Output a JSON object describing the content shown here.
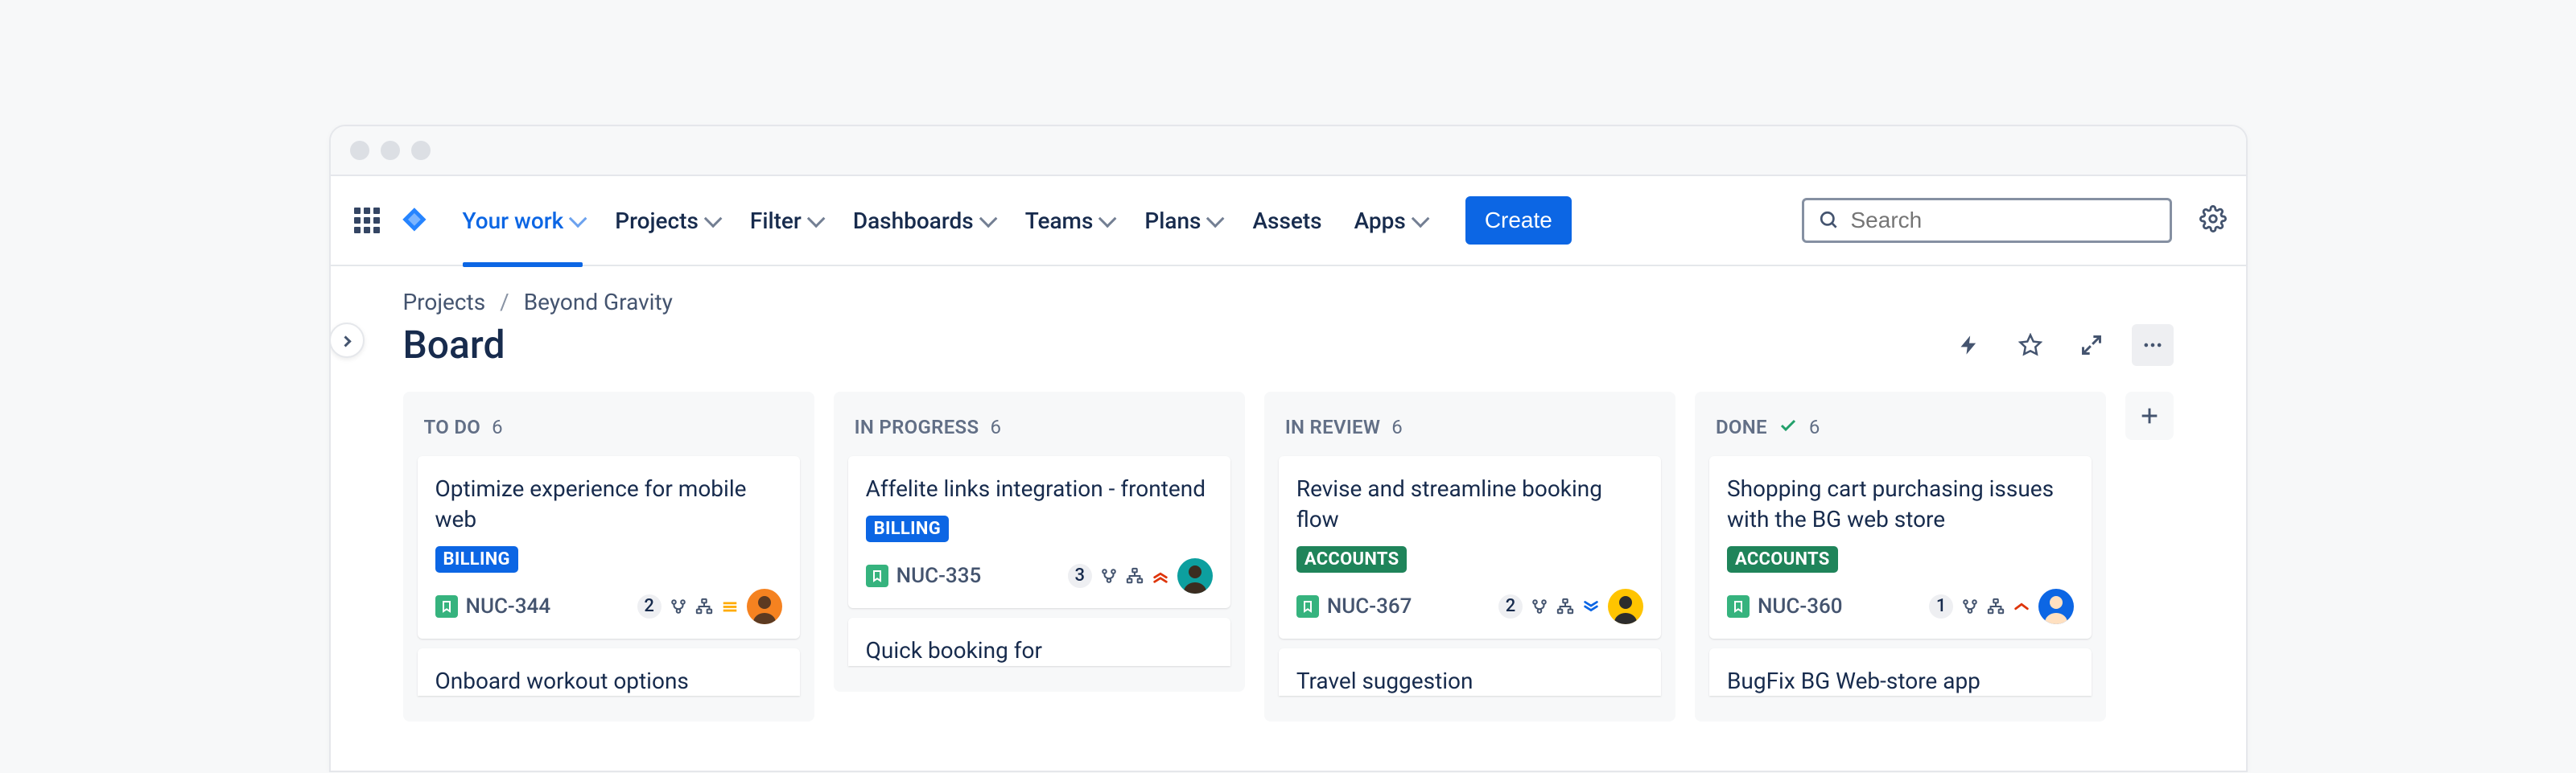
{
  "nav": {
    "your_work": "Your work",
    "projects": "Projects",
    "filter": "Filter",
    "dashboards": "Dashboards",
    "teams": "Teams",
    "plans": "Plans",
    "assets": "Assets",
    "apps": "Apps",
    "create": "Create"
  },
  "search": {
    "placeholder": "Search"
  },
  "breadcrumbs": {
    "root": "Projects",
    "project": "Beyond Gravity"
  },
  "page": {
    "title": "Board"
  },
  "columns": [
    {
      "title": "TO DO",
      "count": "6",
      "done": false
    },
    {
      "title": "IN PROGRESS",
      "count": "6",
      "done": false
    },
    {
      "title": "IN REVIEW",
      "count": "6",
      "done": false
    },
    {
      "title": "DONE",
      "count": "6",
      "done": true
    }
  ],
  "cards": [
    {
      "col": 0,
      "title": "Optimize experience for mobile web",
      "tag": "BILLING",
      "tag_color": "blue",
      "key": "NUC-344",
      "count": "2",
      "priority": "medium-yellow",
      "avatar": "#F58220|#5C3A21"
    },
    {
      "col": 1,
      "title": "Affelite links integration - frontend",
      "tag": "BILLING",
      "tag_color": "blue",
      "key": "NUC-335",
      "count": "3",
      "priority": "high-red",
      "avatar": "#0D9F9F|#3B2C20"
    },
    {
      "col": 2,
      "title": "Revise and streamline booking flow",
      "tag": "ACCOUNTS",
      "tag_color": "green",
      "key": "NUC-367",
      "count": "2",
      "priority": "low-blue",
      "avatar": "#FFC400|#2C2C2C"
    },
    {
      "col": 3,
      "title": "Shopping cart purchasing issues with the BG web store",
      "tag": "ACCOUNTS",
      "tag_color": "green",
      "key": "NUC-360",
      "count": "1",
      "priority": "single-red",
      "avatar": "#0C66E4|#FFE0C0"
    }
  ],
  "partial_cards": [
    {
      "col": 0,
      "title": "Onboard workout options"
    },
    {
      "col": 1,
      "title": "Quick booking for"
    },
    {
      "col": 2,
      "title": "Travel suggestion"
    },
    {
      "col": 3,
      "title": "BugFix BG Web-store app"
    }
  ]
}
